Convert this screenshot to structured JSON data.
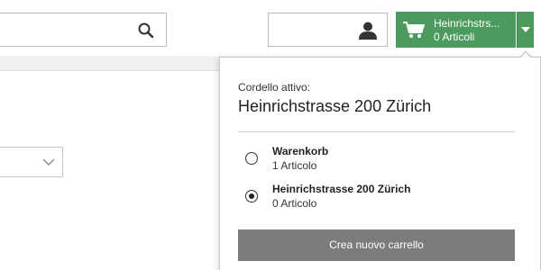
{
  "header": {
    "search": {
      "icon": "search-icon"
    },
    "user": {
      "icon": "user-icon"
    },
    "cart": {
      "icon": "shopping-cart-icon",
      "title": "Heinrichstrs...",
      "count": "0  Articoli",
      "color": "#4c9a5e"
    }
  },
  "dropdown": {
    "active_label": "Cordello attivo:",
    "active_name": "Heinrichstrasse 200 Zürich",
    "carts": [
      {
        "name": "Warenkorb",
        "count": "1  Articolo",
        "selected": false
      },
      {
        "name": "Heinrichstrasse 200 Zürich",
        "count": "0  Articolo",
        "selected": true
      }
    ],
    "create_button": "Crea nuovo carrello"
  }
}
